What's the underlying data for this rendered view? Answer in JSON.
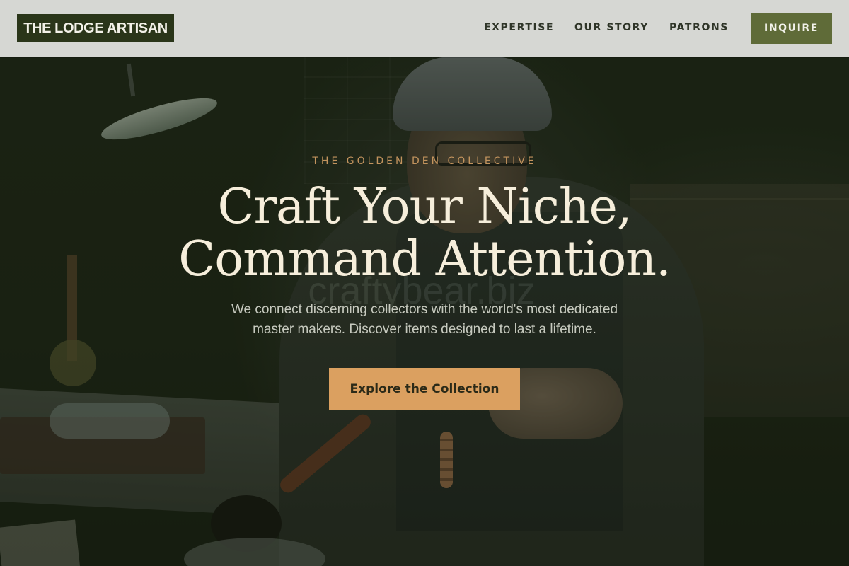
{
  "header": {
    "logo": "THE LODGE ARTISAN",
    "nav": {
      "expertise": "EXPERTISE",
      "story": "OUR STORY",
      "patrons": "PATRONS"
    },
    "inquire": "INQUIRE"
  },
  "hero": {
    "eyebrow": "THE GOLDEN DEN COLLECTIVE",
    "headline_line1": "Craft Your Niche,",
    "headline_line2": "Command Attention.",
    "subtitle_line1": "We connect discerning collectors with the world's most dedicated",
    "subtitle_line2": "master makers. Discover items designed to last a lifetime.",
    "cta": "Explore the Collection",
    "watermark": "craftybear.biz"
  },
  "colors": {
    "logo_bg": "#2a3519",
    "inquire_bg": "#5f6b38",
    "cta_bg": "#dba060",
    "eyebrow": "#c3945e",
    "headline": "#f6eedb"
  }
}
